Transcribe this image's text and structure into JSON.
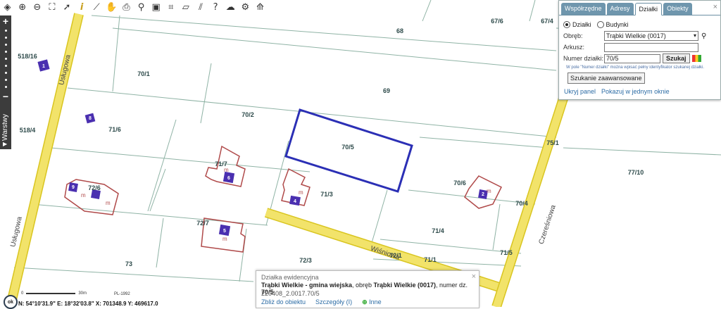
{
  "toolbar": {
    "icons": [
      "layers-icon",
      "zoom-in-icon",
      "zoom-out-icon",
      "zoom-extent-icon",
      "pointer-icon",
      "info-icon",
      "measure-icon",
      "hand-icon",
      "print-icon",
      "pin-icon",
      "clipboard-icon",
      "crop-icon",
      "map-icon",
      "hatch-icon",
      "help-icon",
      "cloud-icon",
      "settings-icon",
      "road-icon"
    ]
  },
  "leftbar": {
    "zoom_in": "+",
    "zoom_out": "−",
    "layers_label": "Warstwy",
    "layers_arrow": "▶"
  },
  "panel": {
    "tabs": [
      "Współrzędne",
      "Adresy",
      "Działki",
      "Obiekty"
    ],
    "active_tab": "Działki",
    "radio_dzialki": "Działki",
    "radio_budynki": "Budynki",
    "obreb_label": "Obręb:",
    "obreb_value": "Trąbki Wielkie (0017)",
    "arkusz_label": "Arkusz:",
    "arkusz_value": "",
    "numer_label": "Numer działki:",
    "numer_value": "70/5",
    "search_button": "Szukaj",
    "hint": "W pole \"Numer działki\" można wpisać pełny identyfikator szukanej działki.",
    "advanced_button": "Szukanie zaawansowane",
    "hide_link": "Ukryj panel",
    "window_link": "Pokazuj w jednym oknie",
    "close": "×"
  },
  "popup": {
    "title": "Działka ewidencyjna",
    "line_bold1": "Trąbki Wielkie - gmina wiejska",
    "line_mid1": ", obręb ",
    "line_bold2": "Trąbki Wielkie (0017)",
    "line_mid2": ", numer dz.",
    "line_bold3": "70/5",
    "id": "220408_2.0017.70/5",
    "zoom_link": "Zbliż do obiektu",
    "details_link": "Szczegóły (I)",
    "other_link": "Inne",
    "close": "×"
  },
  "status": {
    "ok": "ok",
    "coords": "N: 54°10'31.9\"  E: 18°32'03.8\"  X: 701348.9  Y: 469617.0",
    "scale_start": "0",
    "scale_mid": "30m",
    "crs": "PL-1992"
  },
  "map": {
    "parcels": [
      "68",
      "67/6",
      "67/4",
      "518/16",
      "70/1",
      "69",
      "70/2",
      "71/6",
      "518/4",
      "70/5",
      "71/7",
      "71/3",
      "70/6",
      "75/1",
      "77/10",
      "72/6",
      "70/4",
      "72/7",
      "71/4",
      "71/5",
      "73",
      "72/3",
      "72/1",
      "71/1"
    ],
    "streets": [
      "Usługowa",
      "Usługowa",
      "Wiśniowa",
      "Czereśniowa"
    ],
    "building_numbers": [
      "1",
      "8",
      "6",
      "4",
      "9",
      "5",
      "2"
    ],
    "m_label": "m",
    "colors": {
      "road": "#f2e36a",
      "road_edge": "#d9c520",
      "parcel_line": "#7fa898",
      "building": "#b04a4a",
      "highlight": "#2b2fb5",
      "building_fill": "#4a2fb0"
    }
  }
}
